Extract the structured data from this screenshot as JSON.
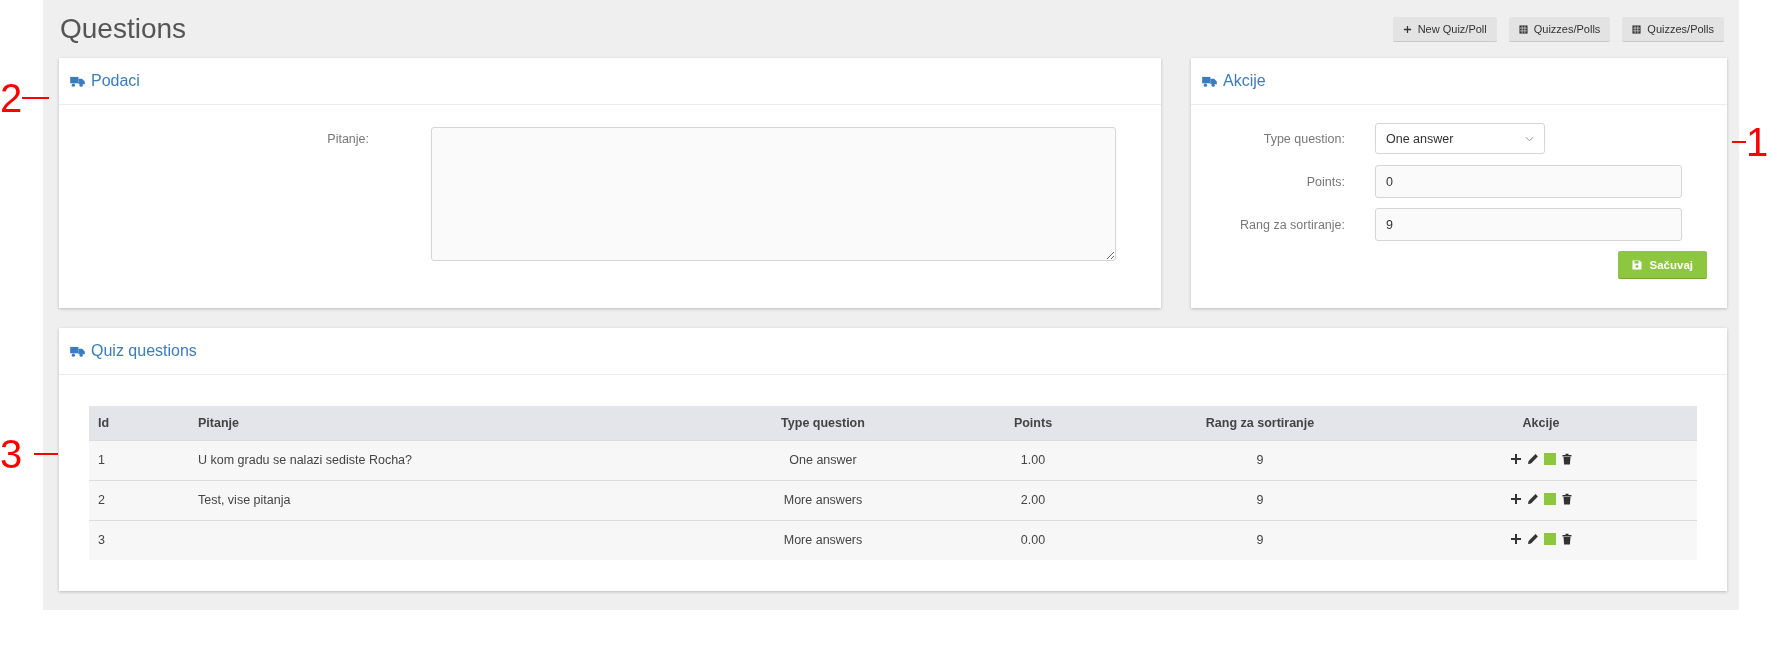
{
  "page": {
    "title": "Questions"
  },
  "toolbar": [
    {
      "kind": "add",
      "label": "New Quiz/Poll"
    },
    {
      "kind": "list",
      "label": "Quizzes/Polls"
    },
    {
      "kind": "list",
      "label": "Quizzes/Polls"
    }
  ],
  "data_panel": {
    "title": "Podaci",
    "callout": "2",
    "label": "Pitanje:"
  },
  "actions_panel": {
    "title": "Akcije",
    "callout": "1",
    "fields": [
      {
        "kind": "select",
        "label": "Type question:",
        "value": "One answer"
      },
      {
        "kind": "input",
        "label": "Points:",
        "value": "0"
      },
      {
        "kind": "input",
        "label": "Rang za sortiranje:",
        "value": "9"
      }
    ],
    "save_button": "Sačuvaj"
  },
  "questions_panel": {
    "title": "Quiz questions",
    "callout": "3",
    "table": {
      "columns": [
        "Id",
        "Pitanje",
        "Type question",
        "Points",
        "Rang za sortiranje",
        "Akcije"
      ],
      "rows": [
        {
          "id": "1",
          "question": "U kom gradu se nalazi sediste Rocha?",
          "type": "One answer",
          "points": "1.00",
          "rank": "9"
        },
        {
          "id": "2",
          "question": "Test, vise pitanja",
          "type": "More answers",
          "points": "2.00",
          "rank": "9"
        },
        {
          "id": "3",
          "type": "More answers",
          "points": "0.00",
          "rank": "9"
        }
      ]
    }
  }
}
